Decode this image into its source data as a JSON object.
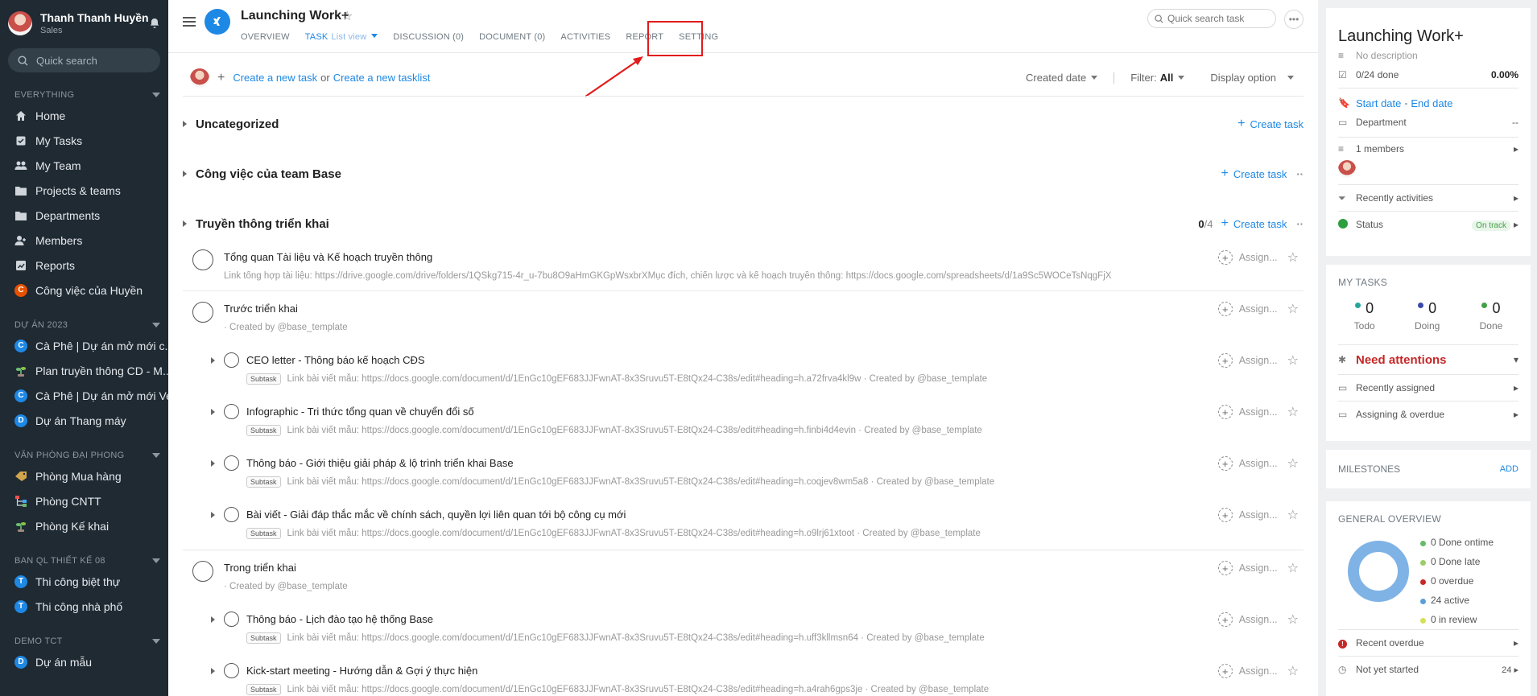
{
  "sidebar": {
    "user_name": "Thanh Thanh Huyền",
    "user_role": "Sales",
    "search_placeholder": "Quick search",
    "sections": [
      {
        "title": "EVERYTHING",
        "items": [
          {
            "label": "Home",
            "icon": "home-icon"
          },
          {
            "label": "My Tasks",
            "icon": "tasks-icon"
          },
          {
            "label": "My Team",
            "icon": "team-icon"
          },
          {
            "label": "Projects & teams",
            "icon": "folder-icon"
          },
          {
            "label": "Departments",
            "icon": "departments-icon"
          },
          {
            "label": "Members",
            "icon": "members-icon"
          },
          {
            "label": "Reports",
            "icon": "reports-icon"
          },
          {
            "label": "Công việc của Huyền",
            "icon": "letter-c",
            "letter": "C",
            "color": "#e65100"
          }
        ]
      },
      {
        "title": "DỰ ÁN 2023",
        "items": [
          {
            "label": "Cà Phê | Dự án mở mới c...",
            "letter": "C",
            "color": "#1e88e5"
          },
          {
            "label": "Plan truyền thông CD - M...",
            "icon": "plant-icon"
          },
          {
            "label": "Cà Phê | Dự án mở mới Ve...",
            "letter": "C",
            "color": "#1e88e5"
          },
          {
            "label": "Dự án Thang máy",
            "letter": "D",
            "color": "#1e88e5"
          }
        ]
      },
      {
        "title": "VĂN PHÒNG ĐẠI PHONG",
        "items": [
          {
            "label": "Phòng Mua hàng",
            "icon": "tag-icon"
          },
          {
            "label": "Phòng CNTT",
            "icon": "network-icon"
          },
          {
            "label": "Phòng Kế khai",
            "icon": "plant-icon"
          }
        ]
      },
      {
        "title": "BAN QL THIẾT KẾ 08",
        "items": [
          {
            "label": "Thi công biệt thự",
            "letter": "T",
            "color": "#1e88e5"
          },
          {
            "label": "Thi công nhà phố",
            "letter": "T",
            "color": "#1e88e5"
          }
        ]
      },
      {
        "title": "DEMO TCT",
        "items": [
          {
            "label": "Dự án mẫu",
            "letter": "D",
            "color": "#1e88e5"
          }
        ]
      }
    ]
  },
  "header": {
    "title": "Launching Work+",
    "tabs": [
      {
        "label": "OVERVIEW"
      },
      {
        "label": "TASK",
        "sub": "List view"
      },
      {
        "label": "DISCUSSION (0)"
      },
      {
        "label": "DOCUMENT (0)"
      },
      {
        "label": "ACTIVITIES"
      },
      {
        "label": "REPORT"
      },
      {
        "label": "SETTING"
      }
    ],
    "search_placeholder": "Quick search task"
  },
  "toolbar": {
    "create_task": "Create a new task",
    "or": "or",
    "create_tasklist": "Create a new tasklist",
    "sort": "Created date",
    "filter_label": "Filter:",
    "filter_value": "All",
    "display": "Display option"
  },
  "groups": {
    "uncategorized": {
      "title": "Uncategorized",
      "action": "Create task"
    },
    "team_base": {
      "title": "Công việc của team Base",
      "action": "Create task"
    },
    "truyen_thong": {
      "title": "Truyền thông triển khai",
      "done": "0",
      "total": "/4",
      "action": "Create task"
    }
  },
  "assign_label": "Assign...",
  "subtask_label": "Subtask",
  "tasks": [
    {
      "title": "Tổng quan Tài liệu và Kế hoạch truyền thông",
      "desc": "Link tổng hợp tài liệu: https://drive.google.com/drive/folders/1QSkg715-4r_u-7bu8O9aHmGKGpWsxbrXMục đích, chiến lược và kế hoạch truyền thông: https://docs.google.com/spreadsheets/d/1a9Sc5WOCeTsNqgFjX"
    },
    {
      "title": "Trước triển khai",
      "desc": "· Created by @base_template"
    },
    {
      "title": "CEO letter - Thông báo kế hoạch CĐS",
      "desc": "Link bài viết mẫu: https://docs.google.com/document/d/1EnGc10gEF683JJFwnAT-8x3Sruvu5T-E8tQx24-C38s/edit#heading=h.a72frva4kl9w · Created by @base_template"
    },
    {
      "title": "Infographic - Tri thức tổng quan về chuyển đổi số",
      "desc": "Link bài viết mẫu: https://docs.google.com/document/d/1EnGc10gEF683JJFwnAT-8x3Sruvu5T-E8tQx24-C38s/edit#heading=h.finbi4d4evin · Created by @base_template"
    },
    {
      "title": "Thông báo - Giới thiệu giải pháp & lộ trình triển khai Base",
      "desc": "Link bài viết mẫu: https://docs.google.com/document/d/1EnGc10gEF683JJFwnAT-8x3Sruvu5T-E8tQx24-C38s/edit#heading=h.coqjev8wm5a8 · Created by @base_template"
    },
    {
      "title": "Bài viết - Giải đáp thắc mắc về chính sách, quyền lợi liên quan tới bộ công cụ mới",
      "desc": "Link bài viết mẫu: https://docs.google.com/document/d/1EnGc10gEF683JJFwnAT-8x3Sruvu5T-E8tQx24-C38s/edit#heading=h.o9lrj61xtoot · Created by @base_template"
    },
    {
      "title": "Trong triển khai",
      "desc": "· Created by @base_template"
    },
    {
      "title": "Thông báo - Lịch đào tạo hệ thống Base",
      "desc": "Link bài viết mẫu: https://docs.google.com/document/d/1EnGc10gEF683JJFwnAT-8x3Sruvu5T-E8tQx24-C38s/edit#heading=h.uff3kllmsn64 · Created by @base_template"
    },
    {
      "title": "Kick-start meeting - Hướng dẫn & Gợi ý thực hiện",
      "desc": "Link bài viết mẫu: https://docs.google.com/document/d/1EnGc10gEF683JJFwnAT-8x3Sruvu5T-E8tQx24-C38s/edit#heading=h.a4rah6gps3je · Created by @base_template"
    }
  ],
  "rpanel": {
    "title": "Launching Work+",
    "no_description": "No description",
    "done": "0/24 done",
    "percent": "0.00%",
    "start_date": "Start date",
    "dash": "-",
    "end_date": "End date",
    "department": "Department",
    "department_value": "--",
    "members": "1 members",
    "recent_activities": "Recently activities",
    "status": "Status",
    "status_value": "On track",
    "my_tasks_title": "MY TASKS",
    "my_tasks": [
      {
        "num": "0",
        "label": "Todo",
        "color": "#26a69a"
      },
      {
        "num": "0",
        "label": "Doing",
        "color": "#3949ab"
      },
      {
        "num": "0",
        "label": "Done",
        "color": "#43a047"
      }
    ],
    "need_attentions": "Need attentions",
    "recently_assigned": "Recently assigned",
    "assigning_overdue": "Assigning & overdue",
    "milestones": "MILESTONES",
    "add": "ADD",
    "general_overview": "GENERAL OVERVIEW",
    "legend": [
      {
        "label": "0 Done ontime",
        "color": "#66bb6a"
      },
      {
        "label": "0 Done late",
        "color": "#9ccc65"
      },
      {
        "label": "0 overdue",
        "color": "#c62828"
      },
      {
        "label": "24 active",
        "color": "#5c9fd6"
      },
      {
        "label": "0 in review",
        "color": "#d4e157"
      }
    ],
    "recent_overdue": "Recent overdue",
    "not_yet_started": "Not yet started",
    "not_yet_started_count": "24"
  }
}
